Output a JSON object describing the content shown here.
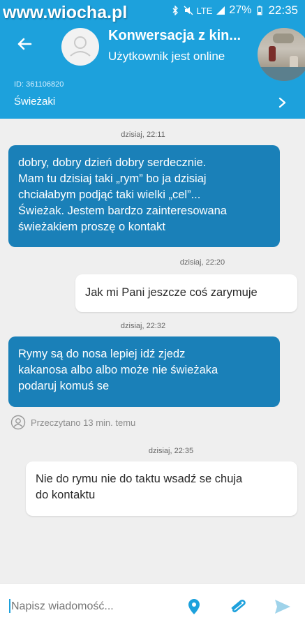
{
  "watermark": "www.wiocha.pl",
  "status_bar": {
    "network": "LTE",
    "battery": "27%",
    "time": "22:35"
  },
  "header": {
    "title": "Konwersacja z kin...",
    "subtitle": "Użytkownik jest online",
    "ad_id": "ID: 361106820",
    "ad_title": "Świeżaki",
    "accent_color": "#1da1dc"
  },
  "messages": [
    {
      "timestamp": "dzisiaj, 22:11",
      "direction": "incoming",
      "lines": [
        "dobry, dobry dzień dobry serdecznie.",
        "Mam tu dzisiaj taki „rym” bo ja dzisiaj",
        "chciałabym podjąć taki wielki „cel”...",
        "Świeżak. Jestem bardzo zainteresowana",
        "świeżakiem proszę o kontakt"
      ]
    },
    {
      "timestamp": "dzisiaj, 22:20",
      "direction": "outgoing",
      "lines": [
        "Jak mi Pani jeszcze coś zarymuje"
      ]
    },
    {
      "timestamp": "dzisiaj, 22:32",
      "direction": "incoming",
      "lines": [
        "Rymy są do nosa lepiej idź zjedz",
        "kakanosa albo albo może nie świeżaka",
        "podaruj komuś se"
      ]
    },
    {
      "timestamp": "dzisiaj, 22:35",
      "direction": "outgoing",
      "lines": [
        "Nie do rymu nie do taktu wsadź se chuja",
        "do kontaktu"
      ]
    }
  ],
  "read_receipt": "Przeczytano 13 min. temu",
  "composer": {
    "placeholder": "Napisz wiadomość...",
    "location_icon": "location-pin-icon",
    "attach_icon": "paperclip-icon",
    "send_icon": "send-icon"
  },
  "colors": {
    "incoming_bubble": "#1a80b8",
    "outgoing_bubble": "#ffffff",
    "background": "#efefef"
  }
}
